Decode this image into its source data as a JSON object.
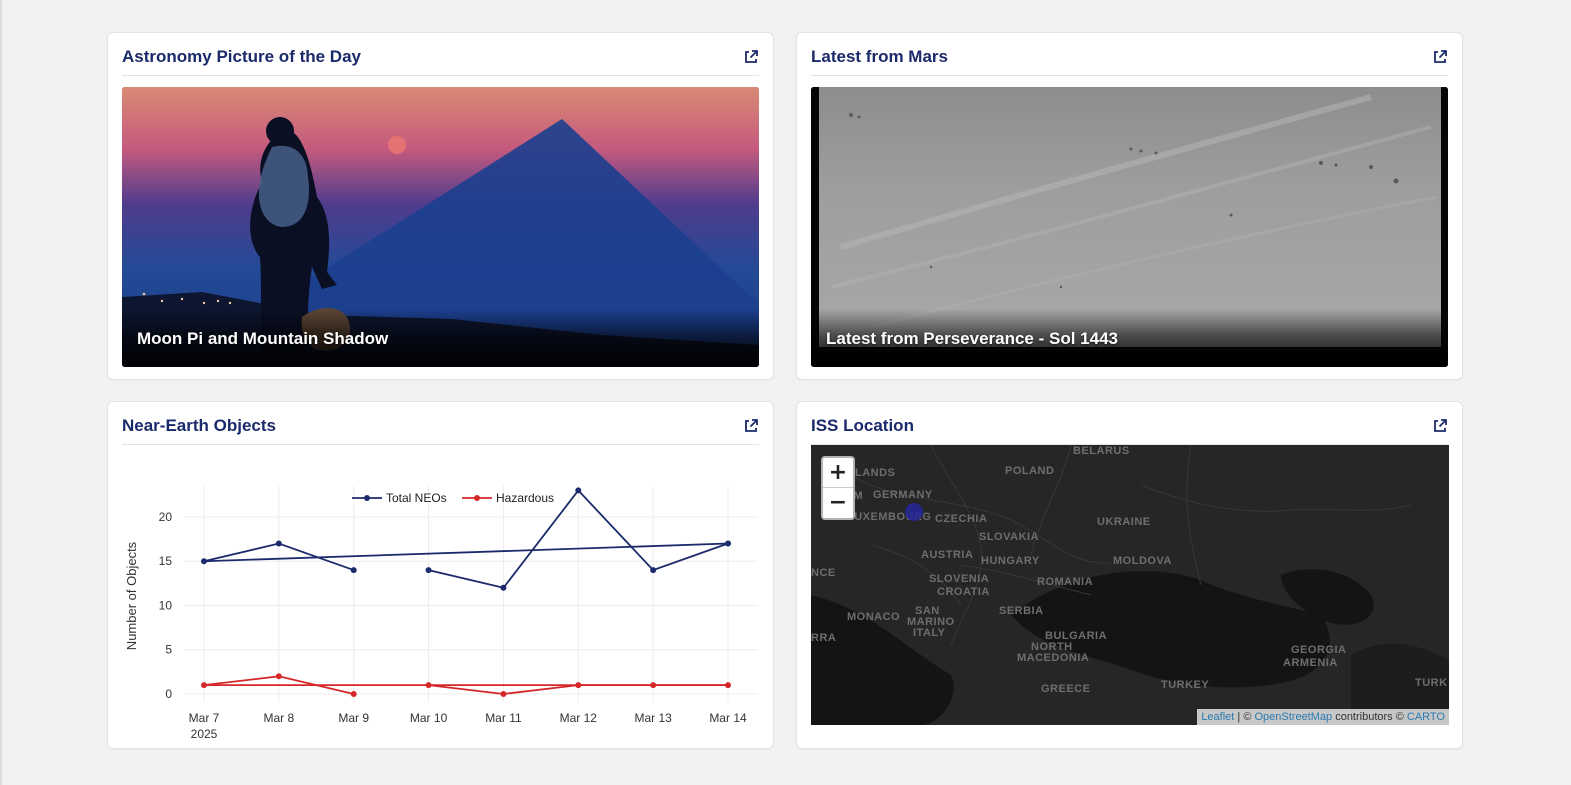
{
  "apod": {
    "title": "Astronomy Picture of the Day",
    "caption": "Moon Pi and Mountain Shadow",
    "external_icon": "external-link-icon"
  },
  "mars": {
    "title": "Latest from Mars",
    "caption": "Latest from Perseverance - Sol 1443",
    "external_icon": "external-link-icon"
  },
  "neo": {
    "title": "Near-Earth Objects",
    "external_icon": "external-link-icon"
  },
  "iss": {
    "title": "ISS Location",
    "external_icon": "external-link-icon",
    "zoom_in": "+",
    "zoom_out": "−",
    "attribution": {
      "leaflet": "Leaflet",
      "sep": " | © ",
      "osm": "OpenStreetMap",
      "contrib": " contributors © ",
      "carto": "CARTO"
    },
    "map_labels": [
      {
        "text": "BELARUS"
      },
      {
        "text": "POLAND"
      },
      {
        "text": "GERMANY"
      },
      {
        "text": "LANDS"
      },
      {
        "text": "UM"
      },
      {
        "text": "LUXEMBOURG"
      },
      {
        "text": "CZECHIA"
      },
      {
        "text": "UKRAINE"
      },
      {
        "text": "SLOVAKIA"
      },
      {
        "text": "AUSTRIA"
      },
      {
        "text": "HUNGARY"
      },
      {
        "text": "MOLDOVA"
      },
      {
        "text": "NCE"
      },
      {
        "text": "SLOVENIA"
      },
      {
        "text": "CROATIA"
      },
      {
        "text": "ROMANIA"
      },
      {
        "text": "SERBIA"
      },
      {
        "text": "MONACO"
      },
      {
        "text": "SAN"
      },
      {
        "text": "MARINO"
      },
      {
        "text": "ITALY"
      },
      {
        "text": "BULGARIA"
      },
      {
        "text": "NORTH"
      },
      {
        "text": "MACEDONIA"
      },
      {
        "text": "GEORGIA"
      },
      {
        "text": "ARMENIA"
      },
      {
        "text": "RRA"
      },
      {
        "text": "GREECE"
      },
      {
        "text": "TURKEY"
      },
      {
        "text": "TURK"
      }
    ]
  },
  "chart_data": {
    "type": "line",
    "title": "",
    "xlabel": "",
    "ylabel": "Number of Objects",
    "categories": [
      "Mar 7",
      "Mar 8",
      "Mar 9",
      "Mar 10",
      "Mar 11",
      "Mar 12",
      "Mar 13",
      "Mar 14"
    ],
    "year_label": "2025",
    "yticks": [
      0,
      5,
      10,
      15,
      20
    ],
    "ylim": [
      0,
      23.5
    ],
    "legend_position": "top",
    "grid": true,
    "series": [
      {
        "name": "Total NEOs",
        "color": "#1b2a6b",
        "path_order": [
          0,
          7
        ],
        "values": [
          15,
          17,
          14,
          14,
          12,
          23,
          14,
          17
        ],
        "segments": [
          [
            0,
            1,
            2
          ],
          [
            3,
            4,
            5,
            6,
            7
          ],
          [
            0,
            7
          ]
        ]
      },
      {
        "name": "Hazardous",
        "color": "#d62728",
        "values": [
          1,
          2,
          0,
          1,
          0,
          1,
          1,
          1
        ],
        "segments": [
          [
            0,
            1,
            2
          ],
          [
            3,
            4,
            5,
            6,
            7
          ],
          [
            0,
            7
          ]
        ]
      }
    ]
  },
  "colors": {
    "title": "#1b2a6b",
    "background": "#f2f2f2",
    "card": "#ffffff",
    "map": "#262626"
  }
}
